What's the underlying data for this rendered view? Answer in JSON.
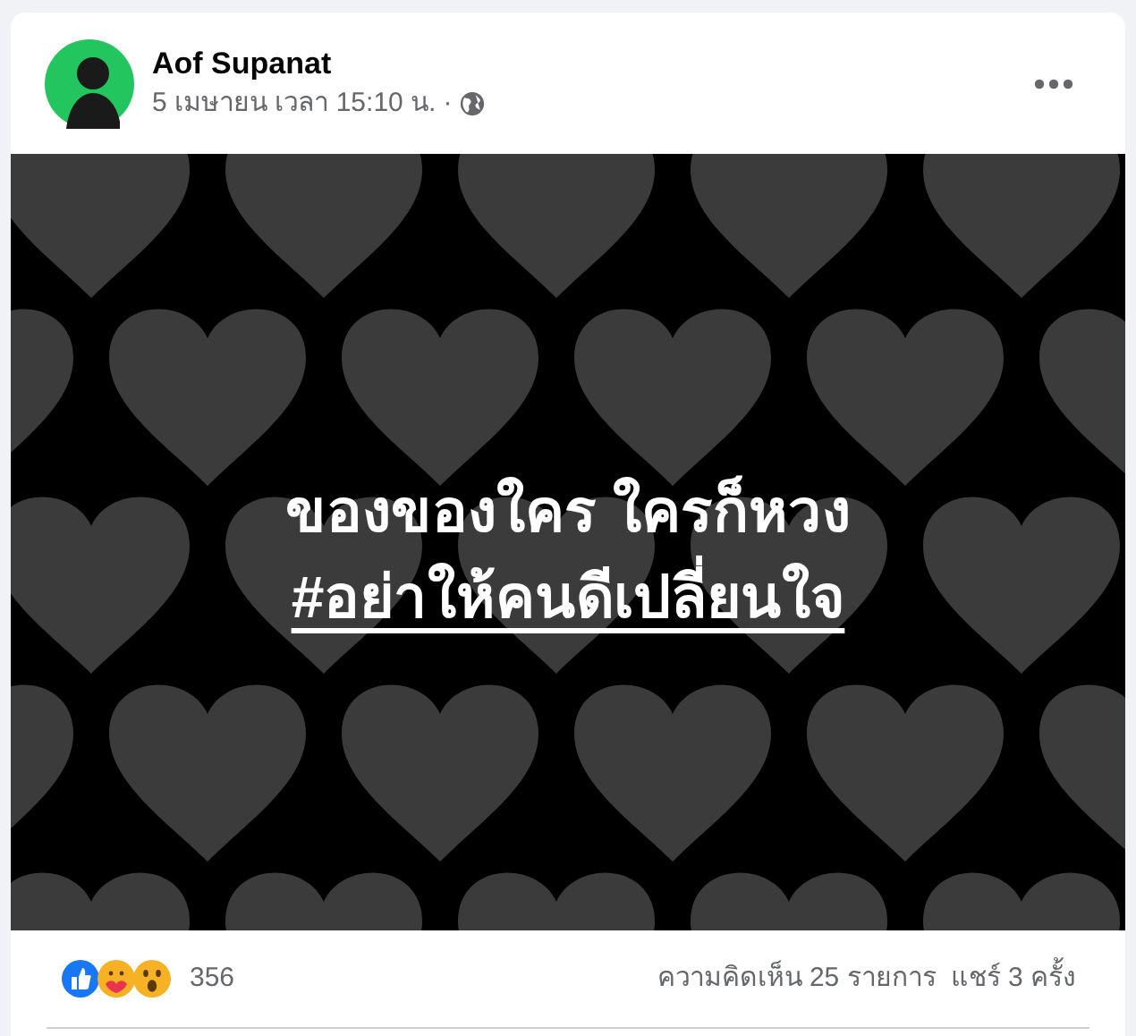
{
  "post": {
    "author": "Aof Supanat",
    "timestamp": "5 เมษายน เวลา 15:10 น.",
    "separator": "·"
  },
  "image": {
    "lines": [
      {
        "text": "ของของใคร ใครก็หวง",
        "underlined": false
      },
      {
        "text": "#อย่าให้คนดีเปลี่ยนใจ",
        "underlined": true
      }
    ]
  },
  "footer": {
    "reaction_count": "356",
    "comments": "ความคิดเห็น 25 รายการ",
    "shares": "แชร์ 3 ครั้ง"
  }
}
